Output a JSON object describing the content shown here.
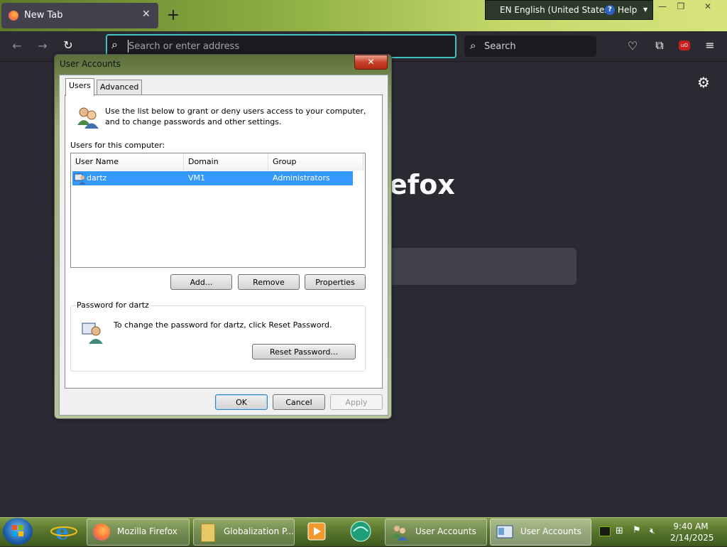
{
  "browser": {
    "tab_title": "New Tab",
    "tab_close": "✕",
    "new_tab": "+",
    "url_placeholder": "Search or enter address",
    "search_placeholder": "Search",
    "newtab_brand_fragment": "efox"
  },
  "language_bar": {
    "language": "EN English (United States)",
    "help": "Help"
  },
  "dialog": {
    "title": "User Accounts",
    "close": "✕",
    "tabs": [
      {
        "label": "Users",
        "selected": true
      },
      {
        "label": "Advanced",
        "selected": false
      }
    ],
    "intro_text": "Use the list below to grant or deny users access to your computer, and to change passwords and other settings.",
    "users_label": "Users for this computer:",
    "columns": [
      "User Name",
      "Domain",
      "Group"
    ],
    "rows": [
      {
        "user": "dartz",
        "domain": "VM1",
        "group": "Administrators",
        "selected": true
      }
    ],
    "buttons": {
      "add": "Add...",
      "remove": "Remove",
      "properties": "Properties",
      "reset_password": "Reset Password...",
      "ok": "OK",
      "cancel": "Cancel",
      "apply": "Apply"
    },
    "password_group": "Password for dartz",
    "password_text": "To change the password for dartz, click Reset Password."
  },
  "taskbar": {
    "items": [
      {
        "label": "Mozilla Firefox"
      },
      {
        "label": "Globalization P..."
      },
      {
        "label": "User Accounts"
      },
      {
        "label": "User Accounts"
      }
    ],
    "time": "9:40 AM",
    "date": "2/14/2025"
  },
  "colors": {
    "selection": "#3399ff",
    "url_focus": "#3cc4c7",
    "browser_bg": "#2b2a33"
  }
}
